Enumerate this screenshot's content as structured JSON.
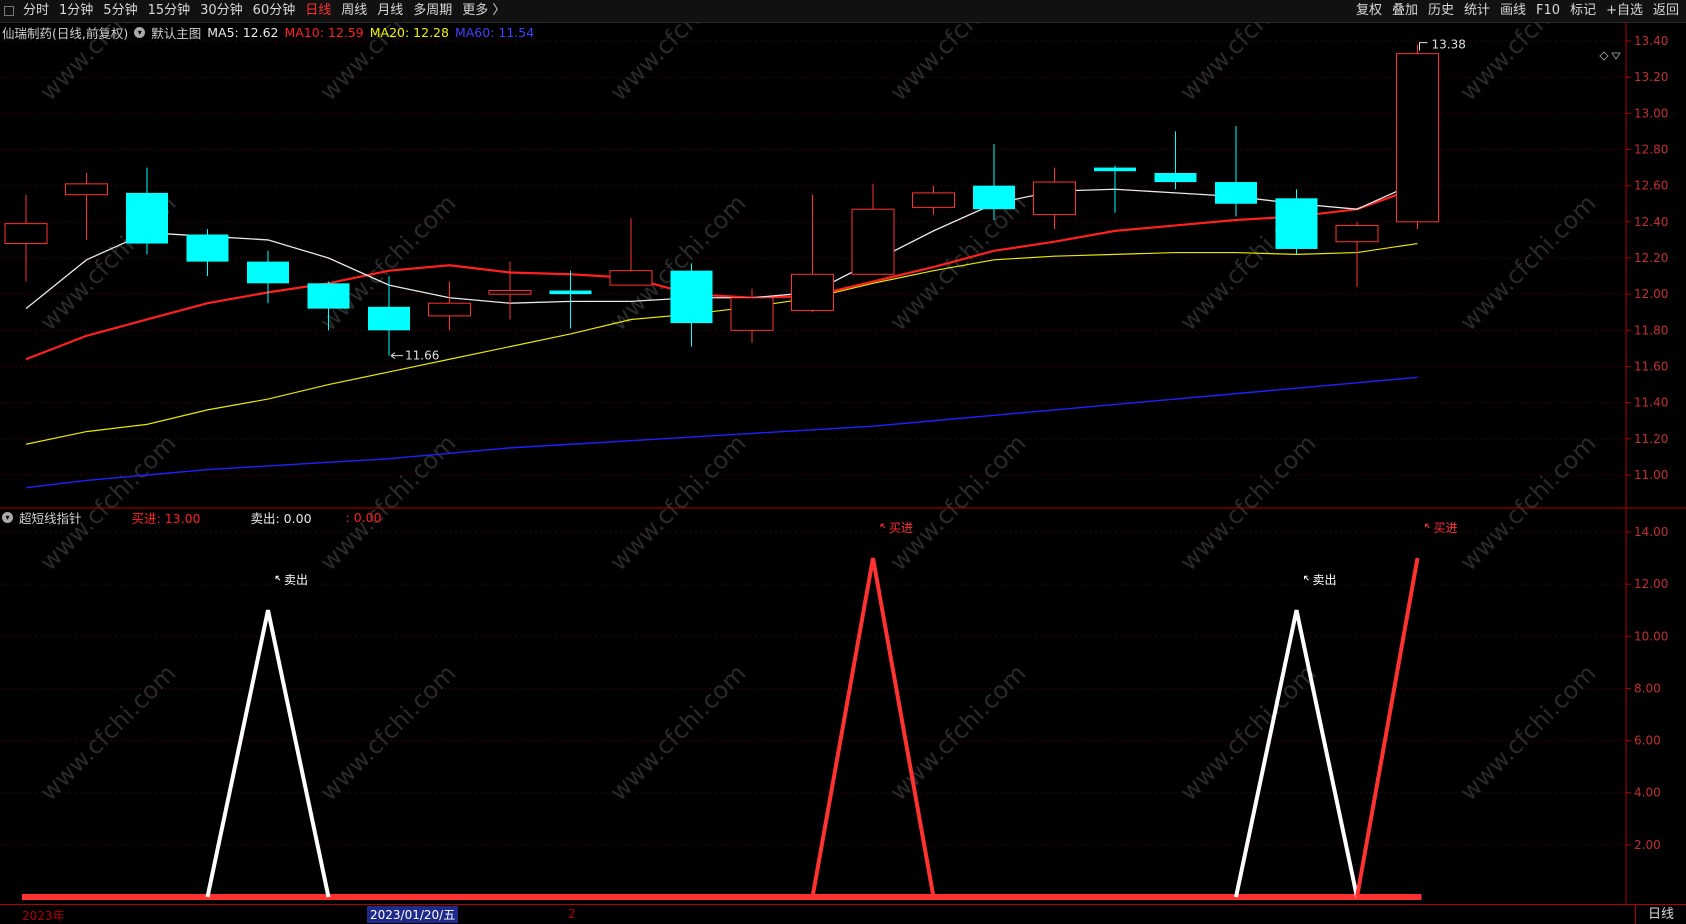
{
  "toolbar": {
    "left_items": [
      "分时",
      "1分钟",
      "5分钟",
      "15分钟",
      "30分钟",
      "60分钟",
      "日线",
      "周线",
      "月线",
      "多周期",
      "更多 〉"
    ],
    "active_item": "日线",
    "right_items": [
      "复权",
      "叠加",
      "历史",
      "统计",
      "画线",
      "F10",
      "标记",
      "+自选",
      "返回"
    ]
  },
  "main_chart": {
    "stock_title": "仙瑞制药(日线,前复权)",
    "chart_selector": "默认主图",
    "ma": [
      {
        "label": "MA5: 12.62",
        "color": "#e8e8e8"
      },
      {
        "label": "MA10: 12.59",
        "color": "#ff2020"
      },
      {
        "label": "MA20: 12.28",
        "color": "#f0f000"
      },
      {
        "label": "MA60: 11.54",
        "color": "#3030ff"
      }
    ],
    "y_ticks": [
      "13.40",
      "13.20",
      "13.00",
      "12.80",
      "12.60",
      "12.40",
      "12.20",
      "12.00",
      "11.80",
      "11.60",
      "11.40",
      "11.20",
      "11.00"
    ],
    "high_label": "13.38",
    "low_label": "11.66"
  },
  "sub_chart": {
    "title": "超短线指针",
    "buy_label": "买进: 13.00",
    "sell_label": "卖出: 0.00",
    "extra_label": ": 0.00",
    "y_ticks": [
      "14.00",
      "12.00",
      "10.00",
      "8.00",
      "6.00",
      "4.00",
      "2.00"
    ],
    "sell_annot": "卖出",
    "buy_annot": "买进"
  },
  "bottom": {
    "year_label": "2023年",
    "cursor_date": "2023/01/20/五",
    "tick2": "2",
    "period": "日线"
  },
  "watermark": "www.cfchi.com",
  "colors": {
    "up": "#ff3232",
    "down": "#00ffff",
    "ma5": "#e8e8e8",
    "ma10": "#ff2020",
    "ma20": "#e8e800",
    "ma60": "#2020ff",
    "axis": "#b00000"
  },
  "chart_data": [
    {
      "type": "candlestick",
      "title": "仙瑞制药(日线,前复权)",
      "ylim": [
        10.9,
        13.45
      ],
      "candles": [
        {
          "o": 12.28,
          "c": 12.39,
          "h": 12.55,
          "l": 12.07
        },
        {
          "o": 12.55,
          "c": 12.61,
          "h": 12.67,
          "l": 12.3
        },
        {
          "o": 12.56,
          "c": 12.28,
          "h": 12.7,
          "l": 12.22
        },
        {
          "o": 12.33,
          "c": 12.18,
          "h": 12.36,
          "l": 12.1
        },
        {
          "o": 12.18,
          "c": 12.06,
          "h": 12.24,
          "l": 11.95
        },
        {
          "o": 12.06,
          "c": 11.92,
          "h": 12.07,
          "l": 11.8
        },
        {
          "o": 11.93,
          "c": 11.8,
          "h": 12.1,
          "l": 11.66
        },
        {
          "o": 11.88,
          "c": 11.95,
          "h": 12.07,
          "l": 11.8
        },
        {
          "o": 12.0,
          "c": 12.02,
          "h": 12.18,
          "l": 11.86
        },
        {
          "o": 12.02,
          "c": 12.0,
          "h": 12.13,
          "l": 11.81
        },
        {
          "o": 12.05,
          "c": 12.13,
          "h": 12.42,
          "l": 12.05
        },
        {
          "o": 12.13,
          "c": 11.84,
          "h": 12.17,
          "l": 11.71
        },
        {
          "o": 11.8,
          "c": 11.98,
          "h": 12.03,
          "l": 11.73
        },
        {
          "o": 11.91,
          "c": 12.11,
          "h": 12.55,
          "l": 11.9
        },
        {
          "o": 12.11,
          "c": 12.47,
          "h": 12.61,
          "l": 12.11
        },
        {
          "o": 12.48,
          "c": 12.56,
          "h": 12.6,
          "l": 12.44
        },
        {
          "o": 12.6,
          "c": 12.47,
          "h": 12.83,
          "l": 12.41
        },
        {
          "o": 12.44,
          "c": 12.62,
          "h": 12.7,
          "l": 12.36
        },
        {
          "o": 12.7,
          "c": 12.68,
          "h": 12.71,
          "l": 12.45
        },
        {
          "o": 12.67,
          "c": 12.62,
          "h": 12.9,
          "l": 12.58
        },
        {
          "o": 12.62,
          "c": 12.5,
          "h": 12.93,
          "l": 12.43
        },
        {
          "o": 12.53,
          "c": 12.25,
          "h": 12.58,
          "l": 12.22
        },
        {
          "o": 12.29,
          "c": 12.38,
          "h": 12.4,
          "l": 12.04
        },
        {
          "o": 12.4,
          "c": 13.33,
          "h": 13.38,
          "l": 12.36
        }
      ],
      "ma5": [
        11.92,
        12.19,
        12.34,
        12.32,
        12.3,
        12.2,
        12.05,
        11.98,
        11.95,
        11.96,
        11.96,
        11.98,
        11.98,
        12.01,
        12.18,
        12.35,
        12.5,
        12.57,
        12.58,
        12.56,
        12.54,
        12.5,
        12.47,
        12.62
      ],
      "ma10": [
        11.64,
        11.77,
        11.86,
        11.95,
        12.01,
        12.06,
        12.13,
        12.16,
        12.12,
        12.11,
        12.09,
        12.0,
        11.98,
        11.99,
        12.07,
        12.15,
        12.24,
        12.29,
        12.35,
        12.38,
        12.41,
        12.43,
        12.47,
        12.59
      ],
      "ma20": [
        11.17,
        11.24,
        11.28,
        11.36,
        11.42,
        11.5,
        11.57,
        11.64,
        11.71,
        11.78,
        11.86,
        11.89,
        11.93,
        11.98,
        12.06,
        12.13,
        12.19,
        12.21,
        12.22,
        12.23,
        12.23,
        12.22,
        12.23,
        12.28
      ],
      "ma60": [
        10.93,
        10.97,
        11.0,
        11.03,
        11.05,
        11.07,
        11.09,
        11.12,
        11.15,
        11.17,
        11.19,
        11.21,
        11.23,
        11.25,
        11.27,
        11.3,
        11.33,
        11.36,
        11.39,
        11.42,
        11.45,
        11.48,
        11.51,
        11.54
      ]
    },
    {
      "type": "line",
      "title": "超短线指针",
      "ylim": [
        0,
        14.5
      ],
      "points": [
        {
          "x": 3.0,
          "y": 0,
          "c": "w"
        },
        {
          "x": 4.0,
          "y": 11.0,
          "c": "w"
        },
        {
          "x": 5.0,
          "y": 0,
          "c": "w"
        },
        {
          "x": 13.0,
          "y": 0,
          "c": "r"
        },
        {
          "x": 14.0,
          "y": 13.0,
          "c": "r"
        },
        {
          "x": 15.0,
          "y": 0,
          "c": "r"
        },
        {
          "x": 20.0,
          "y": 0,
          "c": "w"
        },
        {
          "x": 21.0,
          "y": 11.0,
          "c": "w"
        },
        {
          "x": 22.0,
          "y": 0,
          "c": "w"
        },
        {
          "x": 22.0,
          "y": 0,
          "c": "r"
        },
        {
          "x": 23.0,
          "y": 13.0,
          "c": "r"
        }
      ]
    }
  ]
}
